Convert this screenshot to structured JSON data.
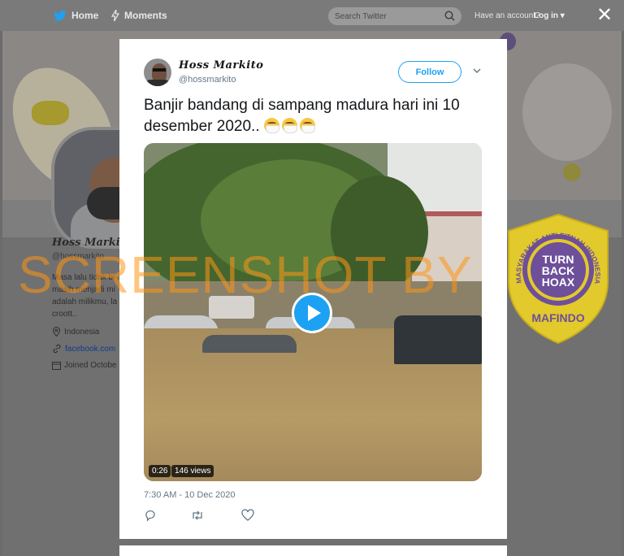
{
  "nav": {
    "home_label": "Home",
    "moments_label": "Moments",
    "search_placeholder": "Search Twitter",
    "account_prompt": "Have an account?",
    "login_label": "Log in",
    "close_label": "✕"
  },
  "background_profile": {
    "name": "Hoss Markito",
    "handle": "@hossmarkito",
    "bio": "Masa lalu tidak bi\nmasih menjadi mi\nadalah milikmu, la\ncroott..",
    "location": "Indonesia",
    "link": "facebook.com",
    "joined": "Joined Octobe"
  },
  "tweet": {
    "name": "Hoss Markito",
    "handle": "@hossmarkito",
    "follow_label": "Follow",
    "text": "Banjir bandang di sampang madura hari ini 10 desember 2020..",
    "emoji_count": 3,
    "video": {
      "duration": "0:26",
      "views": "146 views"
    },
    "timestamp": "7:30 AM - 10 Dec 2020"
  },
  "overlay": {
    "watermark": "SCREENSHOT BY",
    "seal": {
      "arc_text": "MASYARAKAT ANTI FITNAH INDONESIA",
      "line1": "TURN",
      "line2": "BACK",
      "line3": "HOAX",
      "bottom": "MAFINDO",
      "color": "#e2c92c"
    }
  },
  "colors": {
    "accent": "#1da1f2",
    "text": "#14171a",
    "muted": "#657786"
  }
}
